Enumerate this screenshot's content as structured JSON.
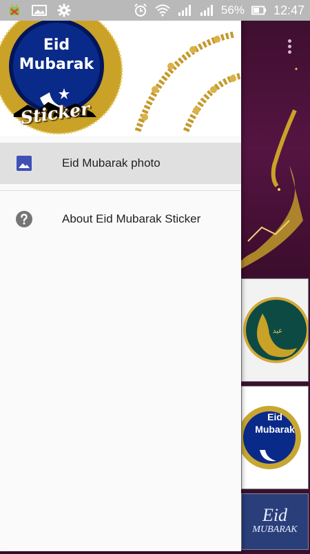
{
  "status_bar": {
    "battery_percent": "56%",
    "time": "12:47",
    "icons": [
      "android-debug-icon",
      "image-notification-icon",
      "settings-gear-icon",
      "alarm-clock-icon",
      "wifi-icon",
      "signal-bars-icon",
      "signal-bars-icon",
      "battery-icon"
    ]
  },
  "drawer": {
    "header_logo": {
      "line1": "Eid",
      "line2": "Mubarak",
      "line3": "Sticker"
    },
    "items": [
      {
        "label": "Eid Mubarak photo",
        "icon": "image-icon",
        "selected": true
      },
      {
        "label": "About Eid Mubarak Sticker",
        "icon": "help-circle-icon",
        "selected": false
      }
    ]
  },
  "background_app": {
    "overflow_icon": "more-vert-icon",
    "thumb2_text": {
      "line1": "Eid",
      "line2": "Mubarak"
    },
    "thumb3_text": {
      "line1": "Eid",
      "line2": "MUBARAK"
    }
  },
  "colors": {
    "status_bar_bg": "#b9b9b9",
    "drawer_bg": "#fafafa",
    "selected_item_bg": "#e0e0e0",
    "image_icon": "#3f51b5",
    "help_icon": "#757575",
    "gold": "#c9a227",
    "night_blue": "#0a2a8a"
  }
}
